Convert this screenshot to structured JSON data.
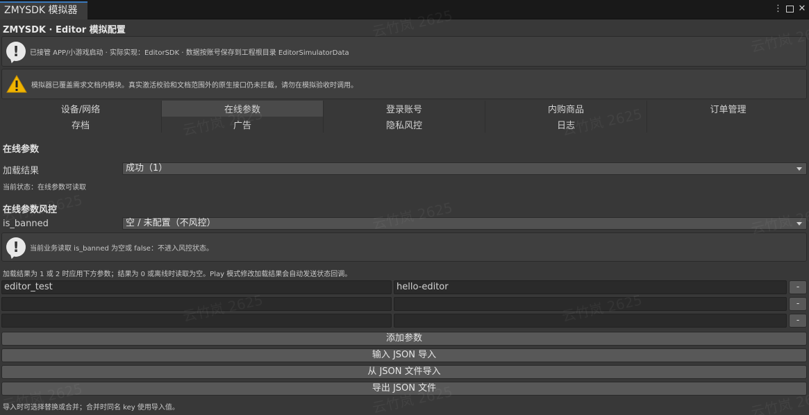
{
  "window": {
    "tab_title": "ZMYSDK 模拟器",
    "app_title": "ZMYSDK · Editor 模拟配置",
    "controls": {
      "menu": "⋮",
      "close": "✕"
    }
  },
  "help": {
    "info": "已接管 APP/小游戏启动 · 实际实现：EditorSDK · 数据按账号保存到工程根目录 EditorSimulatorData",
    "warning": "模拟器已覆盖需求文档内模块。真实激活校验和文档范围外的原生接口仍未拦截，请勿在模拟验收时调用。"
  },
  "tabs": {
    "row1": [
      "设备/网络",
      "在线参数",
      "登录账号",
      "内购商品",
      "订单管理"
    ],
    "row2": [
      "存档",
      "广告",
      "隐私风控",
      "日志"
    ],
    "active": "在线参数"
  },
  "online_params": {
    "section_title": "在线参数",
    "load_result_label": "加载结果",
    "load_result_value": "成功（1）",
    "status_text": "当前状态：在线参数可读取"
  },
  "risk": {
    "section_title": "在线参数风控",
    "is_banned_label": "is_banned",
    "is_banned_value": "空 / 未配置（不风控）",
    "info": "当前业务读取 is_banned 为空或 false：不进入风控状态。"
  },
  "params": {
    "hint": "加载结果为 1 或 2 时应用下方参数；结果为 0 或离线时读取为空。Play 模式修改加载结果会自动发送状态回调。",
    "rows": [
      {
        "key": "editor_test",
        "value": "hello-editor"
      },
      {
        "key": "",
        "value": ""
      },
      {
        "key": "",
        "value": ""
      }
    ],
    "remove_label": "-",
    "add_label": "添加参数",
    "import_json_label": "输入 JSON 导入",
    "import_file_label": "从 JSON 文件导入",
    "export_file_label": "导出 JSON 文件",
    "footer": "导入时可选择替换或合并；合并时同名 key 使用导入值。"
  },
  "watermark": "云竹岚 2625",
  "colors": {
    "accent": "#3a79bb",
    "warning": "#f0b400"
  }
}
